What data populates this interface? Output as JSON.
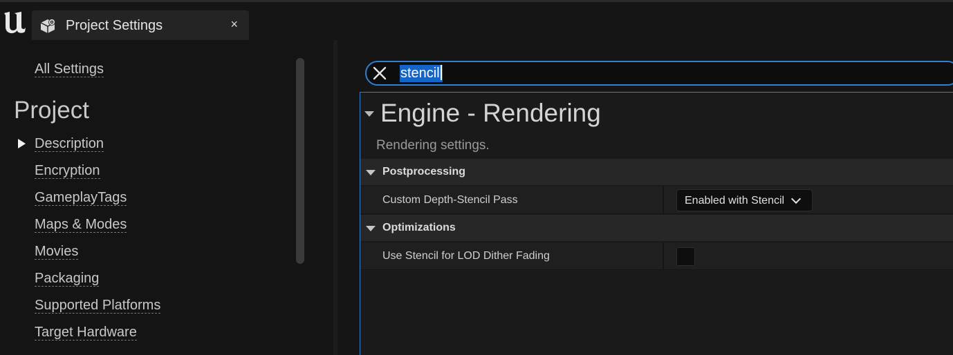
{
  "window": {
    "tab_title": "Project Settings",
    "close_glyph": "×",
    "logo_icon": "unreal-engine-logo",
    "tab_icon": "project-settings-icon"
  },
  "sidebar": {
    "all_settings": "All Settings",
    "section_title": "Project",
    "selected_item": "Description",
    "items": [
      "Description",
      "Encryption",
      "GameplayTags",
      "Maps & Modes",
      "Movies",
      "Packaging",
      "Supported Platforms",
      "Target Hardware"
    ]
  },
  "search": {
    "value": "stencil",
    "clear_icon": "close-icon"
  },
  "panel": {
    "title": "Engine - Rendering",
    "description": "Rendering settings.",
    "categories": [
      {
        "label": "Postprocessing",
        "property": {
          "label": "Custom Depth-Stencil Pass",
          "value": "Enabled with Stencil",
          "control": "dropdown"
        }
      },
      {
        "label": "Optimizations",
        "property": {
          "label": "Use Stencil for LOD Dither Fading",
          "checked": false,
          "control": "checkbox"
        }
      }
    ]
  },
  "colors": {
    "accent": "#2f7fd3",
    "selection": "#1565c8",
    "background": "#151515",
    "category_row": "#272727"
  }
}
